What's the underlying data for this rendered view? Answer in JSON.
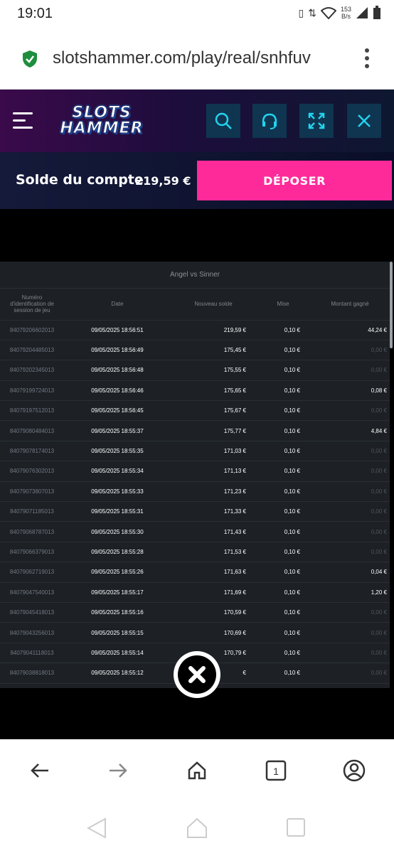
{
  "status_bar": {
    "time": "19:01",
    "net_speed": "153",
    "net_unit": "B/s"
  },
  "browser": {
    "url": "slotshammer.com/play/real/snhfuv"
  },
  "site": {
    "logo_line1": "SLOTS",
    "logo_line2": "HAMMER",
    "balance_label": "Solde du compte",
    "balance_value": "219,59 €",
    "deposit_label": "DÉPOSER"
  },
  "history": {
    "title": "Angel vs Sinner",
    "columns": [
      "Numéro d'identification de session de jeu",
      "Date",
      "Nouveau solde",
      "Mise",
      "Montant gagné"
    ],
    "rows": [
      {
        "id": "84079206602013",
        "date": "09/05/2025 18:56:51",
        "balance": "219,59 €",
        "bet": "0,10 €",
        "win": "44,24 €"
      },
      {
        "id": "84079204485013",
        "date": "09/05/2025 18:56:49",
        "balance": "175,45 €",
        "bet": "0,10 €",
        "win": "0,00 €"
      },
      {
        "id": "84079202345013",
        "date": "09/05/2025 18:56:48",
        "balance": "175,55 €",
        "bet": "0,10 €",
        "win": "0,00 €"
      },
      {
        "id": "84079199724013",
        "date": "09/05/2025 18:56:46",
        "balance": "175,65 €",
        "bet": "0,10 €",
        "win": "0,08 €"
      },
      {
        "id": "84079197512013",
        "date": "09/05/2025 18:56:45",
        "balance": "175,67 €",
        "bet": "0,10 €",
        "win": "0,00 €"
      },
      {
        "id": "84079080484013",
        "date": "09/05/2025 18:55:37",
        "balance": "175,77 €",
        "bet": "0,10 €",
        "win": "4,84 €"
      },
      {
        "id": "84079078174013",
        "date": "09/05/2025 18:55:35",
        "balance": "171,03 €",
        "bet": "0,10 €",
        "win": "0,00 €"
      },
      {
        "id": "84079076302013",
        "date": "09/05/2025 18:55:34",
        "balance": "171,13 €",
        "bet": "0,10 €",
        "win": "0,00 €"
      },
      {
        "id": "84079073807013",
        "date": "09/05/2025 18:55:33",
        "balance": "171,23 €",
        "bet": "0,10 €",
        "win": "0,00 €"
      },
      {
        "id": "84079071185013",
        "date": "09/05/2025 18:55:31",
        "balance": "171,33 €",
        "bet": "0,10 €",
        "win": "0,00 €"
      },
      {
        "id": "84079068787013",
        "date": "09/05/2025 18:55:30",
        "balance": "171,43 €",
        "bet": "0,10 €",
        "win": "0,00 €"
      },
      {
        "id": "84079066379013",
        "date": "09/05/2025 18:55:28",
        "balance": "171,53 €",
        "bet": "0,10 €",
        "win": "0,00 €"
      },
      {
        "id": "84079062719013",
        "date": "09/05/2025 18:55:26",
        "balance": "171,63 €",
        "bet": "0,10 €",
        "win": "0,04 €"
      },
      {
        "id": "84079047540013",
        "date": "09/05/2025 18:55:17",
        "balance": "171,69 €",
        "bet": "0,10 €",
        "win": "1,20 €"
      },
      {
        "id": "84079045418013",
        "date": "09/05/2025 18:55:16",
        "balance": "170,59 €",
        "bet": "0,10 €",
        "win": "0,00 €"
      },
      {
        "id": "84079043256013",
        "date": "09/05/2025 18:55:15",
        "balance": "170,69 €",
        "bet": "0,10 €",
        "win": "0,00 €"
      },
      {
        "id": "84079041118013",
        "date": "09/05/2025 18:55:14",
        "balance": "170,79 €",
        "bet": "0,10 €",
        "win": "0,00 €"
      },
      {
        "id": "84079038818013",
        "date": "09/05/2025 18:55:12",
        "balance": "€",
        "bet": "0,10 €",
        "win": "0,00 €"
      }
    ]
  },
  "icons": {
    "shield": "shield-check-icon",
    "search": "search-icon",
    "support": "headset-icon",
    "fullscreen": "fullscreen-icon",
    "close": "close-icon"
  },
  "colors": {
    "accent": "#ff2a9a",
    "header_btn": "#0f3550",
    "cyan": "#22d3ee"
  }
}
